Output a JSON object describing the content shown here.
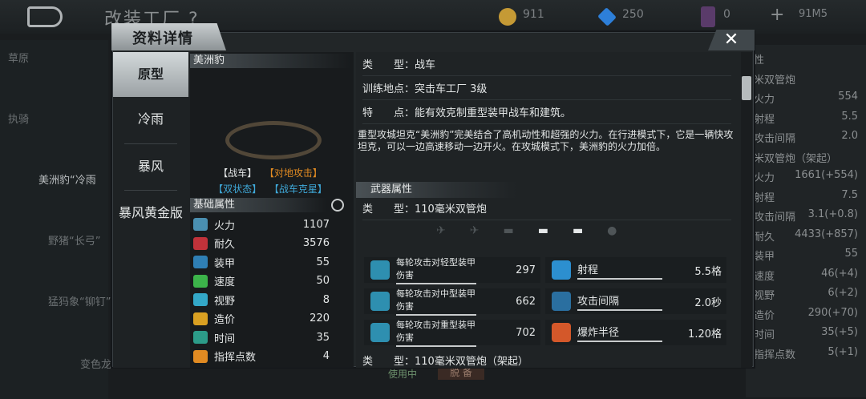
{
  "topbar": {
    "title": "改装工厂",
    "help": "?",
    "coins": "911",
    "diamonds": "250",
    "cards": "0",
    "plus": "+",
    "status": "91M5"
  },
  "background_left": [
    "草原",
    "执骑",
    "美洲豹“冷雨",
    "野猪“长弓”",
    "猛犸象“铆钉”",
    "变色龙"
  ],
  "background_right": {
    "rows": [
      {
        "l": "性",
        "v": ""
      },
      {
        "l": "米双管炮",
        "v": ""
      },
      {
        "l": "火力",
        "v": "554"
      },
      {
        "l": "射程",
        "v": "5.5"
      },
      {
        "l": "攻击间隔",
        "v": "2.0"
      },
      {
        "l": "米双管炮（架起）",
        "v": ""
      },
      {
        "l": "火力",
        "v": "1661(+554)"
      },
      {
        "l": "射程",
        "v": "7.5"
      },
      {
        "l": "攻击间隔",
        "v": "3.1(+0.8)"
      },
      {
        "l": "耐久",
        "v": "4433(+857)"
      },
      {
        "l": "装甲",
        "v": "55"
      },
      {
        "l": "速度",
        "v": "46(+4)"
      },
      {
        "l": "视野",
        "v": "6(+2)"
      },
      {
        "l": "造价",
        "v": "290(+70)"
      },
      {
        "l": "时间",
        "v": "35(+5)"
      },
      {
        "l": "指挥点数",
        "v": "5(+1)"
      }
    ],
    "bottom_left": "使用中",
    "bottom_button": "脱 备"
  },
  "modal": {
    "title": "资料详情",
    "close": "✕",
    "tabs": [
      "原型",
      "冷雨",
      "暴风",
      "暴风黄金版"
    ],
    "unit_name": "美洲豹",
    "tags_row1": [
      "【战车】",
      "【对地攻击】"
    ],
    "tags_row2": [
      "【双状态】",
      "【战车克星】"
    ],
    "base_attr_header": "基础属性",
    "stats": [
      {
        "label": "火力",
        "value": "1107",
        "color": "#4a8fb0"
      },
      {
        "label": "耐久",
        "value": "3576",
        "color": "#c0323a"
      },
      {
        "label": "装甲",
        "value": "55",
        "color": "#2f7fb5"
      },
      {
        "label": "速度",
        "value": "50",
        "color": "#3cb34a"
      },
      {
        "label": "视野",
        "value": "8",
        "color": "#33a7c7"
      },
      {
        "label": "造价",
        "value": "220",
        "color": "#d9a022"
      },
      {
        "label": "时间",
        "value": "35",
        "color": "#2c9b88"
      },
      {
        "label": "指挥点数",
        "value": "4",
        "color": "#e08a22"
      }
    ],
    "info": [
      {
        "label": "类　　型：",
        "value": "战车"
      },
      {
        "label": "训练地点：",
        "value": "突击车工厂 3级"
      },
      {
        "label": "特　　点：",
        "value": "能有效克制重型装甲战车和建筑。"
      }
    ],
    "description": "重型攻城坦克“美洲豹”完美结合了高机动性和超强的火力。在行进模式下，它是一辆快攻坦克，可以一边高速移动一边开火。在攻城模式下，美洲豹的火力加倍。",
    "weapon_header": "武器属性",
    "weapon_type_label": "类　　型：",
    "weapon_type": "110毫米双管炮",
    "target_icons": [
      "infantry-icon",
      "aircraft-icon",
      "helicopter-icon",
      "tank-icon",
      "ship-icon",
      "submarine-icon"
    ],
    "weapon_left": [
      {
        "label": "每轮攻击对轻型装甲伤害",
        "value": "297"
      },
      {
        "label": "每轮攻击对中型装甲伤害",
        "value": "662"
      },
      {
        "label": "每轮攻击对重型装甲伤害",
        "value": "702"
      }
    ],
    "weapon_right": [
      {
        "label": "射程",
        "value": "5.5格"
      },
      {
        "label": "攻击间隔",
        "value": "2.0秒"
      },
      {
        "label": "爆炸半径",
        "value": "1.20格"
      }
    ],
    "weapon2_type": "类　　型：110毫米双管炮（架起）"
  }
}
